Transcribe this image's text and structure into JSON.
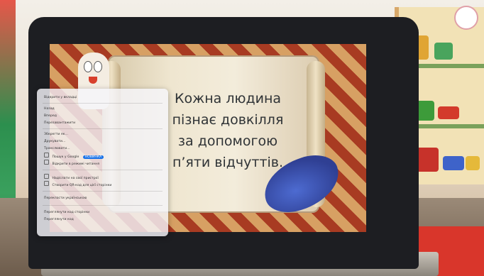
{
  "screen": {
    "quote_lines": [
      "Кожна людина",
      "пізнає довкілля",
      "за допомогою",
      "п’яти відчуттів."
    ]
  },
  "context_menu": {
    "items": [
      {
        "label": "Відкрити у вкладці",
        "shortcut": ""
      },
      {
        "label": "Назад",
        "shortcut": ""
      },
      {
        "label": "Вперед",
        "shortcut": ""
      },
      {
        "label": "Перезавантажити",
        "shortcut": ""
      },
      {
        "label": "Зберегти як…",
        "shortcut": ""
      },
      {
        "label": "Друкувати…",
        "shortcut": ""
      },
      {
        "label": "Транслювати…",
        "shortcut": ""
      },
      {
        "label": "Пошук у Google",
        "shortcut": ""
      },
      {
        "label": "Відкрити в режимі читання",
        "shortcut": ""
      },
      {
        "label": "Надіслати на свої пристрої",
        "shortcut": ""
      },
      {
        "label": "Створити QR-код для цієї сторінки",
        "shortcut": ""
      },
      {
        "label": "Перекласти українською",
        "shortcut": ""
      },
      {
        "label": "Переглянути код сторінки",
        "shortcut": ""
      },
      {
        "label": "Переглянути код",
        "shortcut": ""
      }
    ],
    "badge": "НОВИНКА"
  },
  "colors": {
    "tile_red": "#a83b22",
    "tile_gold": "#d7a063",
    "feather_blue": "#2f3f93",
    "mat_red": "#d9362b"
  }
}
